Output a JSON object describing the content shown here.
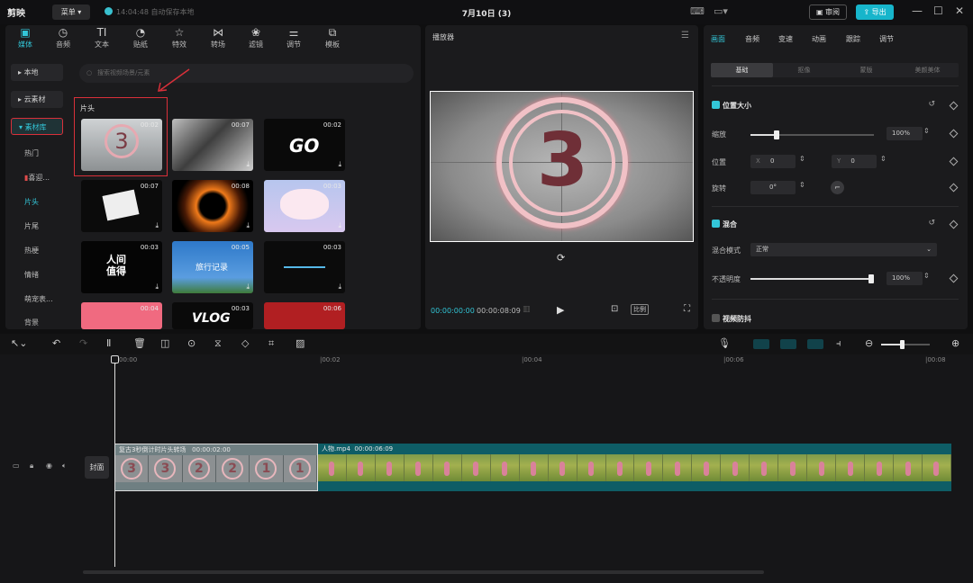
{
  "app": {
    "logo": "剪映",
    "menu": "菜单",
    "autosave": "14:04:48 自动保存本地",
    "project_title": "7月10日 (3)",
    "review": "审阅",
    "export": "导出"
  },
  "media_tabs": [
    {
      "label": "媒体",
      "icon": "media-icon"
    },
    {
      "label": "音频",
      "icon": "audio-icon"
    },
    {
      "label": "文本",
      "icon": "text-icon"
    },
    {
      "label": "贴纸",
      "icon": "sticker-icon"
    },
    {
      "label": "特效",
      "icon": "effects-icon"
    },
    {
      "label": "转场",
      "icon": "transition-icon"
    },
    {
      "label": "滤镜",
      "icon": "filter-icon"
    },
    {
      "label": "调节",
      "icon": "adjust-icon"
    },
    {
      "label": "模板",
      "icon": "template-icon"
    }
  ],
  "sidebar": {
    "local": "本地",
    "cloud": "云素材",
    "library": "素材库",
    "items": [
      "热门",
      "喜迎...",
      "片头",
      "片尾",
      "热梗",
      "情绪",
      "萌宠表...",
      "背景"
    ]
  },
  "search_placeholder": "搜索视频场景/元素",
  "section_title": "片头",
  "thumbs": [
    {
      "dur": "00:02",
      "text": "3"
    },
    {
      "dur": "00:07",
      "text": ""
    },
    {
      "dur": "00:02",
      "text": "GO"
    },
    {
      "dur": "00:07",
      "text": ""
    },
    {
      "dur": "00:08",
      "text": ""
    },
    {
      "dur": "00:03",
      "text": ""
    },
    {
      "dur": "00:03",
      "text": "人间 值得"
    },
    {
      "dur": "00:05",
      "text": "旅行记录"
    },
    {
      "dur": "00:03",
      "text": ""
    },
    {
      "dur": "00:04",
      "text": ""
    },
    {
      "dur": "00:03",
      "text": "VLOG"
    },
    {
      "dur": "00:06",
      "text": ""
    }
  ],
  "player": {
    "title": "播放器",
    "current": "00:00:00:00",
    "total": "00:00:08:09",
    "ratio": "比例",
    "frame_number": "3"
  },
  "props": {
    "tabs": [
      "画面",
      "音频",
      "变速",
      "动画",
      "跟踪",
      "调节"
    ],
    "subtabs": [
      "基础",
      "抠像",
      "蒙版",
      "美颜美体"
    ],
    "pos_size": "位置大小",
    "scale_label": "缩放",
    "scale_value": "100%",
    "position_label": "位置",
    "x_label": "X",
    "x_value": "0",
    "y_label": "Y",
    "y_value": "0",
    "rotate_label": "旋转",
    "rotate_value": "0°",
    "blend": "混合",
    "blend_mode_label": "混合模式",
    "blend_mode_value": "正常",
    "opacity_label": "不透明度",
    "opacity_value": "100%",
    "stabilize": "视频防抖"
  },
  "timeline": {
    "ticks": [
      "00:00",
      "|00:02",
      "|00:04",
      "|00:06",
      "|00:08"
    ],
    "cover": "封面",
    "clip1_label": "复古3秒倒计时片头转场",
    "clip1_dur": "00:00:02:00",
    "clip1_frames": [
      "3",
      "3",
      "2",
      "2",
      "1",
      "1"
    ],
    "clip2_label": "人物.mp4",
    "clip2_dur": "00:00:06:09"
  }
}
